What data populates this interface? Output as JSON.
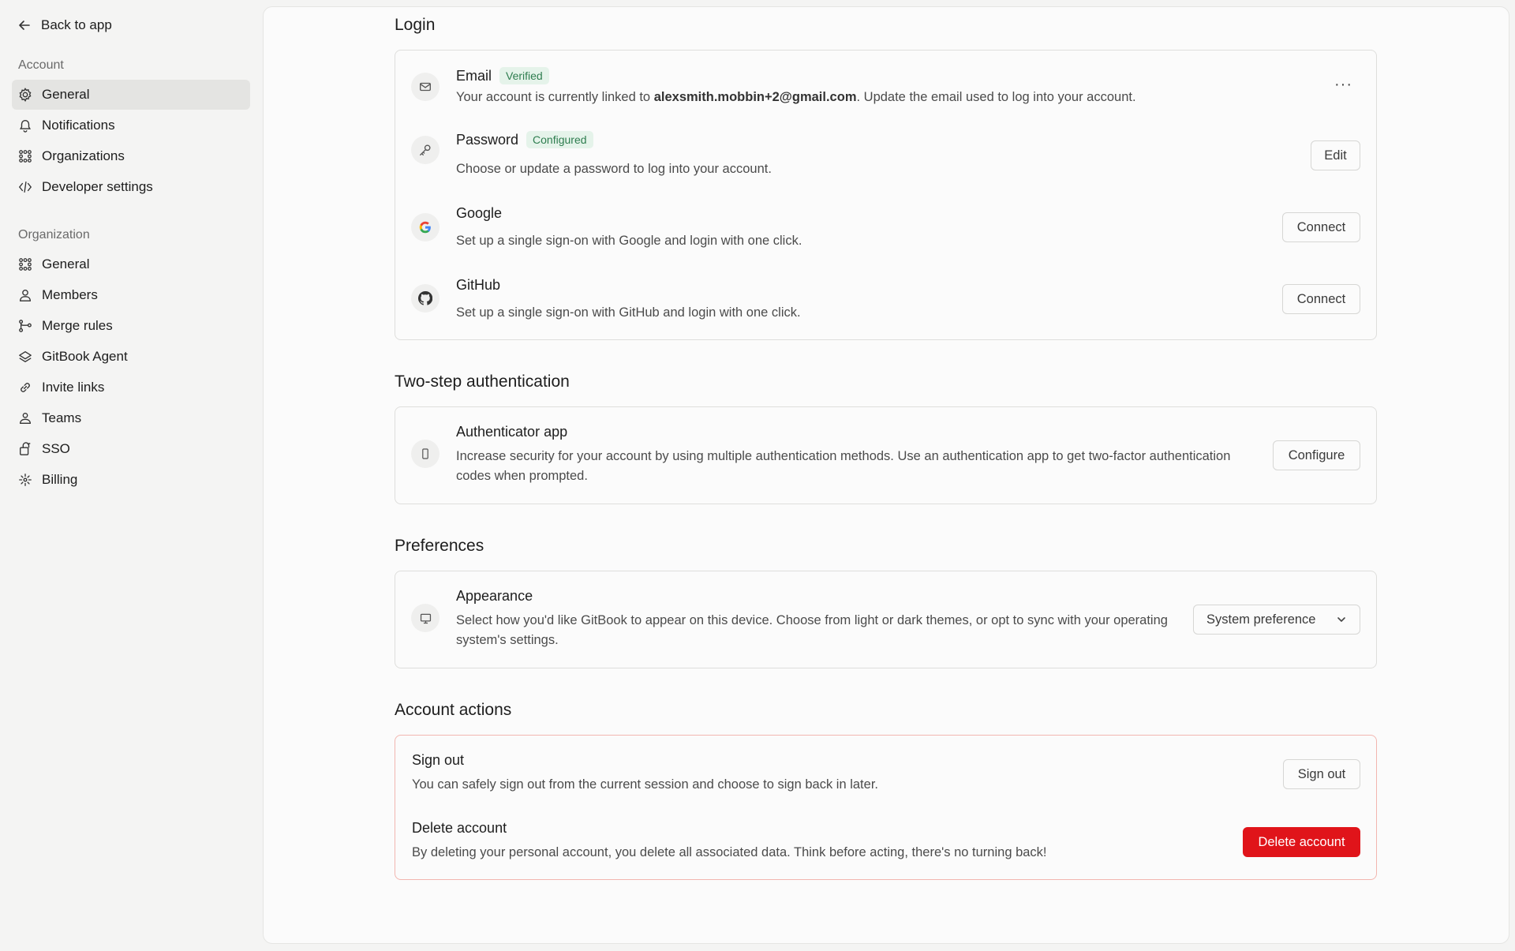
{
  "sidebar": {
    "back_label": "Back to app",
    "account_heading": "Account",
    "account_items": [
      {
        "label": "General",
        "icon": "gear-icon",
        "active": true
      },
      {
        "label": "Notifications",
        "icon": "bell-icon"
      },
      {
        "label": "Organizations",
        "icon": "grid-dots-icon"
      },
      {
        "label": "Developer settings",
        "icon": "code-icon"
      }
    ],
    "org_heading": "Organization",
    "org_items": [
      {
        "label": "General",
        "icon": "grid-dots-icon"
      },
      {
        "label": "Members",
        "icon": "user-icon"
      },
      {
        "label": "Merge rules",
        "icon": "merge-icon"
      },
      {
        "label": "GitBook Agent",
        "icon": "agent-icon"
      },
      {
        "label": "Invite links",
        "icon": "link-icon"
      },
      {
        "label": "Teams",
        "icon": "team-icon"
      },
      {
        "label": "SSO",
        "icon": "sso-icon"
      },
      {
        "label": "Billing",
        "icon": "billing-icon"
      }
    ]
  },
  "login": {
    "title": "Login",
    "email": {
      "title": "Email",
      "badge": "Verified",
      "desc_prefix": "Your account is currently linked to ",
      "address": "alexsmith.mobbin+2@gmail.com",
      "desc_suffix": ". Update the email used to log into your account.",
      "more": "···"
    },
    "password": {
      "title": "Password",
      "badge": "Configured",
      "desc": "Choose or update a password to log into your account.",
      "button": "Edit"
    },
    "google": {
      "title": "Google",
      "desc": "Set up a single sign-on with Google and login with one click.",
      "button": "Connect"
    },
    "github": {
      "title": "GitHub",
      "desc": "Set up a single sign-on with GitHub and login with one click.",
      "button": "Connect"
    }
  },
  "two_step": {
    "title": "Two-step authentication",
    "auth_app": {
      "title": "Authenticator app",
      "desc": "Increase security for your account by using multiple authentication methods. Use an authentication app to get two-factor authentication codes when prompted.",
      "button": "Configure"
    }
  },
  "preferences": {
    "title": "Preferences",
    "appearance": {
      "title": "Appearance",
      "desc": "Select how you'd like GitBook to appear on this device. Choose from light or dark themes, or opt to sync with your operating system's settings.",
      "select_value": "System preference"
    }
  },
  "account_actions": {
    "title": "Account actions",
    "sign_out": {
      "title": "Sign out",
      "desc": "You can safely sign out from the current session and choose to sign back in later.",
      "button": "Sign out"
    },
    "delete": {
      "title": "Delete account",
      "desc": "By deleting your personal account, you delete all associated data. Think before acting, there's no turning back!",
      "button": "Delete account"
    }
  },
  "colors": {
    "danger": "#e0141a",
    "badge_green": "#2e7d4f",
    "active_nav": "#e4e4e2"
  }
}
